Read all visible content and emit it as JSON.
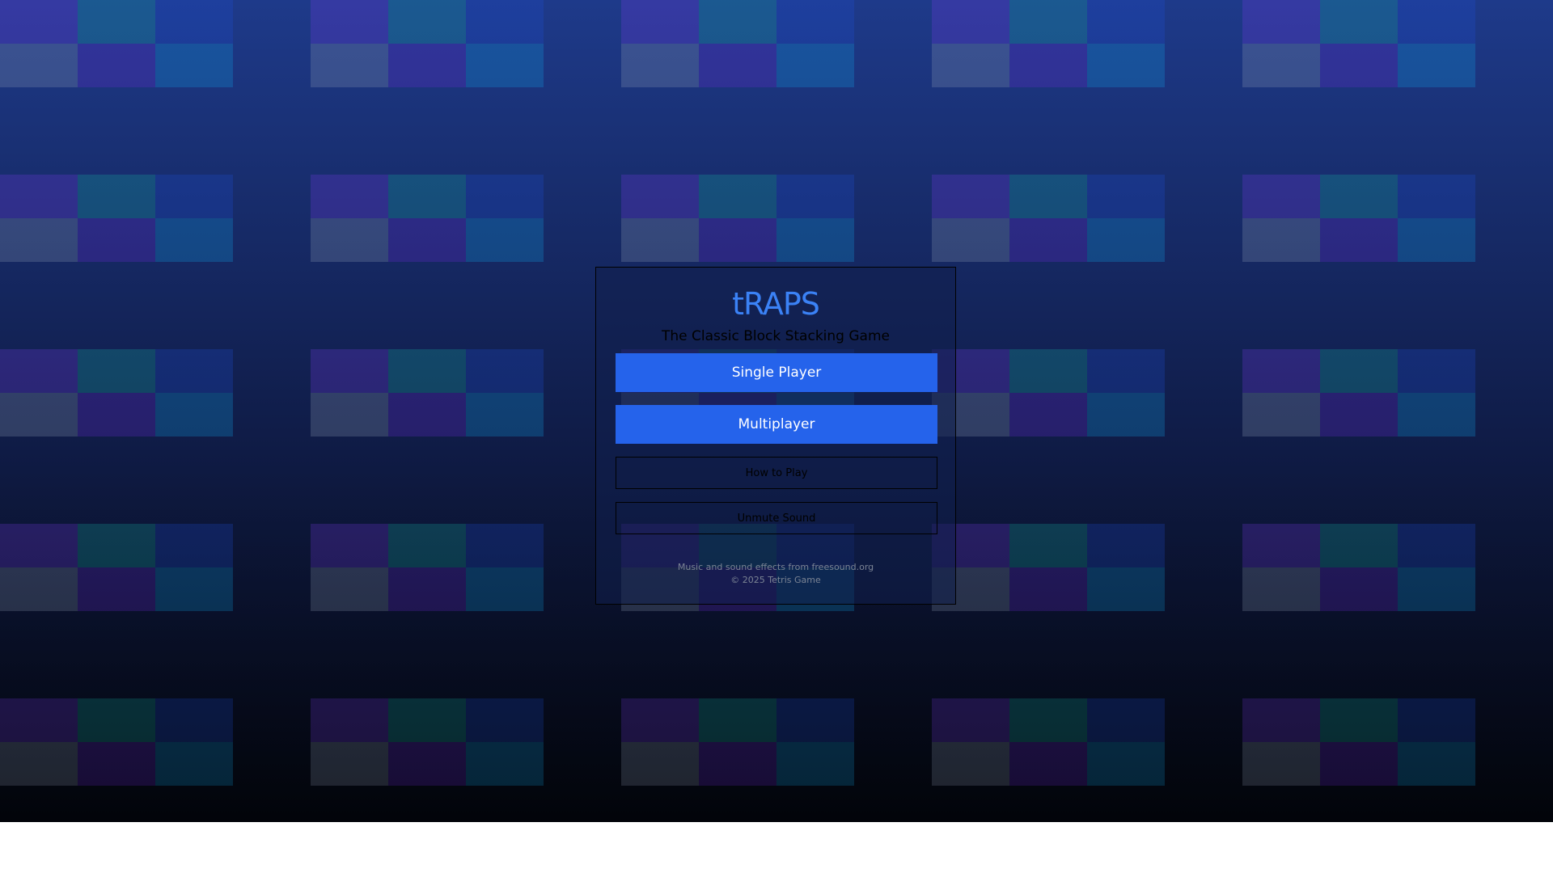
{
  "menu": {
    "title": "tRAPS",
    "subtitle": "The Classic Block Stacking Game",
    "buttons": {
      "single_player": "Single Player",
      "multiplayer": "Multiplayer",
      "how_to_play": "How to Play",
      "unmute_sound": "Unmute Sound"
    },
    "footer": {
      "credits": "Music and sound effects from freesound.org",
      "copyright": "© 2025 Tetris Game"
    }
  },
  "colors": {
    "accent": "#2563eb",
    "title": "#3b82f6",
    "background_top": "#1e3a8a",
    "background_bottom": "#020409",
    "block_colors": [
      "#7c3aed",
      "#14b8a6",
      "#1d4ed8",
      "#94a3b8",
      "#6d28d9",
      "#0ea5e9"
    ]
  }
}
